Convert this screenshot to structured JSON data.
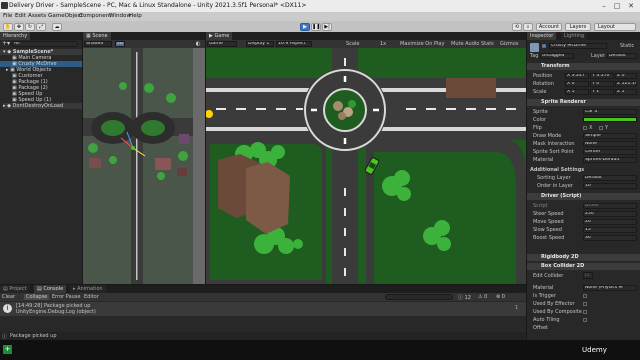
{
  "window": {
    "title": "Delivery Driver - SampleScene - PC, Mac & Linux Standalone - Unity 2021.3.5f1 Personal* <DX11>"
  },
  "menu": [
    "File",
    "Edit",
    "Assets",
    "GameObject",
    "Component",
    "Window",
    "Help"
  ],
  "toolbar": {
    "account": "Account",
    "layers": "Layers",
    "layout": "Layout"
  },
  "hierarchy": {
    "tab": "Hierarchy",
    "search_placeholder": "All",
    "items": [
      "SampleScene*",
      "Main Camera",
      "Crusty McDrive",
      "World Objects",
      "Customer",
      "Package (1)",
      "Package (2)",
      "Speed Up",
      "Speed Up (1)",
      "DontDestroyOnLoad"
    ]
  },
  "scene_view": {
    "tab": "Scene",
    "shading": "Shaded",
    "mode_2d": "2D"
  },
  "game_view": {
    "tab": "Game",
    "display": "Game",
    "display_num": "Display 1",
    "aspect": "16:9 Aspect",
    "scale_label": "Scale",
    "scale_value": "1x",
    "maximize": "Maximize On Play",
    "mute": "Mute Audio",
    "stats": "Stats",
    "gizmos": "Gizmos"
  },
  "inspector": {
    "tab": "Inspector",
    "lighting_tab": "Lighting",
    "object_name": "Crusty McDrive",
    "static": "Static",
    "tag_label": "Tag",
    "tag": "Untagged",
    "layer_label": "Layer",
    "layer": "Default",
    "transform": {
      "title": "Transform",
      "position_label": "Position",
      "rotation_label": "Rotation",
      "scale_label": "Scale",
      "pos": [
        "X 3.247",
        "Y 3.570",
        "Z 0"
      ],
      "rot": [
        "X 0",
        "Y 0",
        "Z 121.19"
      ],
      "scl": [
        "X 1",
        "Y 1",
        "Z 1"
      ]
    },
    "sprite_renderer": {
      "title": "Sprite Renderer",
      "sprite_label": "Sprite",
      "sprite": "Car 3",
      "color_label": "Color",
      "color": "#49c421",
      "flip_label": "Flip",
      "flip_x": "X",
      "flip_y": "Y",
      "draw_mode_label": "Draw Mode",
      "draw_mode": "Simple",
      "mask_label": "Mask Interaction",
      "mask": "None",
      "sort_point_label": "Sprite Sort Point",
      "sort_point": "Center",
      "material_label": "Material",
      "material": "Sprites-Default"
    },
    "additional": {
      "title": "Additional Settings",
      "sorting_layer_label": "Sorting Layer",
      "sorting_layer": "Default",
      "order_label": "Order in Layer",
      "order": "10"
    },
    "driver": {
      "title": "Driver (Script)",
      "script_label": "Script",
      "script": "Driver",
      "steer_label": "Steer Speed",
      "steer": "250",
      "move_label": "Move Speed",
      "move": "20",
      "slow_label": "Slow Speed",
      "slow": "15",
      "boost_label": "Boost Speed",
      "boost": "30"
    },
    "rigidbody": {
      "title": "Rigidbody 2D"
    },
    "box_collider": {
      "title": "Box Collider 2D",
      "edit_label": "Edit Collider",
      "material_label": "Material",
      "material": "None (Physics M",
      "trigger_label": "Is Trigger",
      "effector_label": "Used By Effector",
      "composite_label": "Used By Composite",
      "autotiling_label": "Auto Tiling",
      "offset_label": "Offset"
    }
  },
  "bottom": {
    "project_tab": "Project",
    "console_tab": "Console",
    "animation_tab": "Animation",
    "clear": "Clear",
    "collapse": "Collapse",
    "error_pause": "Error Pause",
    "editor": "Editor",
    "log_line1": "[14:49:28] Package picked up",
    "log_line2": "UnityEngine.Debug:Log (object)",
    "counts": [
      "12",
      "0",
      "0"
    ]
  },
  "status": {
    "message": "Package picked up"
  },
  "watermark": "Udemy"
}
